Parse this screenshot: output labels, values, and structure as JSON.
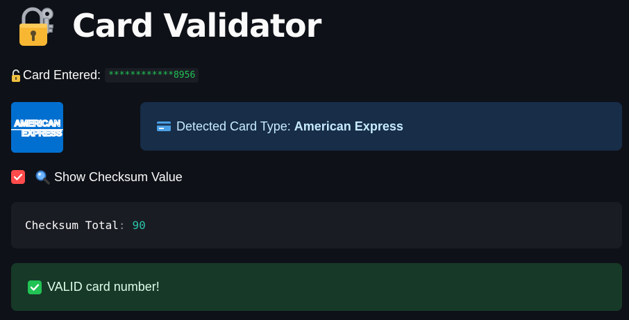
{
  "title": {
    "text": "Card Validator",
    "icon": "lock-with-key-icon"
  },
  "card_entered": {
    "label": "Card Entered:",
    "value": "************8956",
    "icon": "open-lock-icon"
  },
  "card_logo": {
    "line1": "AMERICAN",
    "line2": "EXPRESS",
    "color": "#016fd0"
  },
  "detected": {
    "label": "Detected Card Type:",
    "value": "American Express",
    "icon": "credit-card-icon",
    "background": "#172d48"
  },
  "checksum_toggle": {
    "label": "Show Checksum Value",
    "checked": true,
    "icon": "magnifier-icon",
    "accent": "#ff4b4b"
  },
  "checksum_output": {
    "label": "Checksum Total",
    "separator": ":",
    "value": "90"
  },
  "result": {
    "text": "VALID card number!",
    "icon": "check-mark-icon",
    "color": "#21c354"
  }
}
